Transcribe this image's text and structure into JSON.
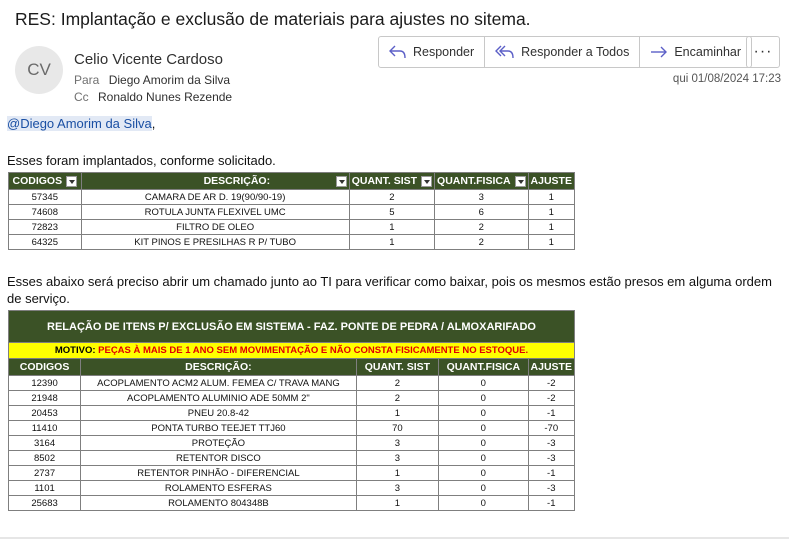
{
  "subject": "RES: Implantação e exclusão de materiais para ajustes no sitema.",
  "sender": {
    "initials": "CV",
    "name": "Celio Vicente Cardoso"
  },
  "to": {
    "label": "Para",
    "value": "Diego Amorim da Silva"
  },
  "cc": {
    "label": "Cc",
    "value": "Ronaldo Nunes Rezende"
  },
  "date": "qui 01/08/2024 17:23",
  "actions": {
    "reply": "Responder",
    "reply_all": "Responder a Todos",
    "forward": "Encaminhar",
    "more": "···"
  },
  "body": {
    "mention": "@Diego Amorim da Silva",
    "mention_suffix": ",",
    "p1": "Esses foram implantados, conforme solicitado.",
    "p2": "Esses abaixo será preciso abrir um chamado junto ao TI para verificar como baixar, pois os mesmos estão presos em alguma ordem de serviço."
  },
  "table1": {
    "headers": [
      "CODIGOS",
      "DESCRIÇÃO:",
      "QUANT. SIST",
      "QUANT.FISICA",
      "AJUSTE"
    ],
    "rows": [
      [
        "57345",
        "CAMARA DE AR D. 19(90/90-19)",
        "2",
        "3",
        "1"
      ],
      [
        "74608",
        "ROTULA JUNTA FLEXIVEL UMC",
        "5",
        "6",
        "1"
      ],
      [
        "72823",
        "FILTRO DE OLEO",
        "1",
        "2",
        "1"
      ],
      [
        "64325",
        "KIT PINOS E PRESILHAS R P/ TUBO",
        "1",
        "2",
        "1"
      ]
    ]
  },
  "table2": {
    "banner": "RELAÇÃO DE ITENS P/ EXCLUSÃO EM SISTEMA - FAZ. PONTE DE PEDRA / ALMOXARIFADO",
    "motivo_label": "MOTIVO:",
    "motivo_text": "PEÇAS À MAIS DE 1 ANO SEM MOVIMENTAÇÃO E NÃO CONSTA FISICAMENTE NO ESTOQUE.",
    "headers": [
      "CODIGOS",
      "DESCRIÇÃO:",
      "QUANT. SIST",
      "QUANT.FISICA",
      "AJUSTE"
    ],
    "rows": [
      [
        "12390",
        "ACOPLAMENTO ACM2 ALUM. FEMEA C/ TRAVA MANG",
        "2",
        "0",
        "-2"
      ],
      [
        "21948",
        "ACOPLAMENTO ALUMINIO ADE 50MM 2\"",
        "2",
        "0",
        "-2"
      ],
      [
        "20453",
        "PNEU 20.8-42",
        "1",
        "0",
        "-1"
      ],
      [
        "11410",
        "PONTA TURBO TEEJET TTJ60",
        "70",
        "0",
        "-70"
      ],
      [
        "3164",
        "PROTEÇÃO",
        "3",
        "0",
        "-3"
      ],
      [
        "8502",
        "RETENTOR DISCO",
        "3",
        "0",
        "-3"
      ],
      [
        "2737",
        "RETENTOR PINHÃO - DIFERENCIAL",
        "1",
        "0",
        "-1"
      ],
      [
        "1101",
        "ROLAMENTO ESFERAS",
        "3",
        "0",
        "-3"
      ],
      [
        "25683",
        "ROLAMENTO 804348B",
        "1",
        "0",
        "-1"
      ]
    ]
  }
}
